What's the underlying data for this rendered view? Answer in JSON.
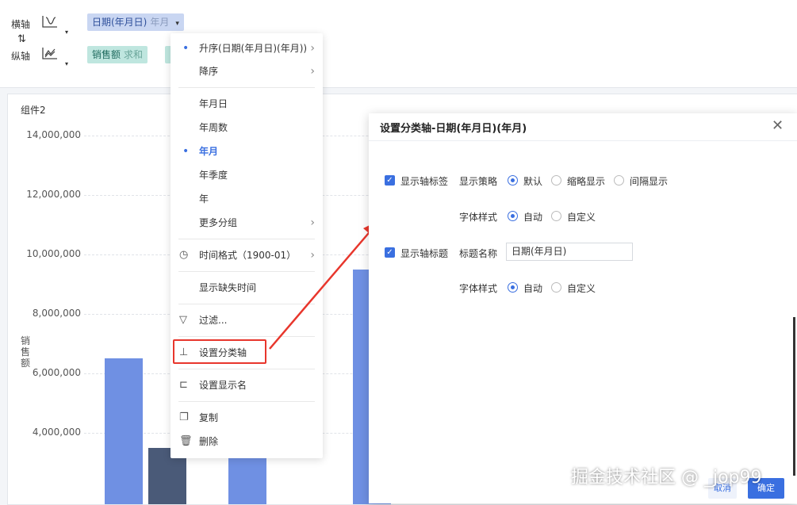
{
  "axis_bar": {
    "x_label": "横轴",
    "swap_glyph": "⇅",
    "y_label": "纵轴",
    "x_pill": {
      "text": "日期(年月日)",
      "sub": "年月",
      "caret": "▾"
    },
    "y_pill": {
      "text": "销售额",
      "sub": "求和"
    },
    "icons": [
      "axis-x-icon",
      "axis-y-icon",
      "swap-icon"
    ]
  },
  "chart": {
    "title": "组件2",
    "ylabel": "销\n售\n额",
    "bar_color": "#6f90e3",
    "bar2_color": "#4a5a78"
  },
  "chart_data": {
    "type": "bar",
    "title": "组件2",
    "ylabel": "销售额",
    "yticks": [
      "14,000,000",
      "12,000,000",
      "10,000,000",
      "8,000,000",
      "6,000,000",
      "4,000,000"
    ],
    "ylim": [
      2000000,
      14600000
    ],
    "series": [
      {
        "values": [
          6500000,
          null,
          9500000
        ]
      },
      {
        "values": [
          null,
          3500000,
          null
        ]
      }
    ],
    "partial_bars": [
      {
        "series": 0,
        "value": 6500000
      },
      {
        "series": 1,
        "value": 3500000
      },
      {
        "series": 0,
        "value": 3500000
      },
      {
        "series": 0,
        "value": 9500000
      }
    ]
  },
  "menu": {
    "items": [
      {
        "label": "升序(日期(年月日)(年月))",
        "dot": true,
        "chevron": true
      },
      {
        "label": "降序",
        "chevron": true
      },
      {
        "label": "年月日"
      },
      {
        "label": "年周数"
      },
      {
        "label": "年月",
        "dot": true,
        "active": true
      },
      {
        "label": "年季度"
      },
      {
        "label": "年"
      },
      {
        "label": "更多分组",
        "chevron": true
      },
      {
        "label": "时间格式（1900-01）",
        "icon": "clock-icon",
        "chevron": true
      },
      {
        "label": "显示缺失时间"
      },
      {
        "label": "过滤...",
        "icon": "filter-icon"
      },
      {
        "label": "设置分类轴",
        "icon": "axis-settings-icon"
      },
      {
        "label": "设置显示名",
        "icon": "rename-icon"
      },
      {
        "label": "复制",
        "icon": "copy-icon"
      },
      {
        "label": "删除",
        "icon": "trash-icon"
      }
    ]
  },
  "dialog": {
    "title": "设置分类轴-日期(年月日)(年月)",
    "close_glyph": "✕",
    "show_axis_label": {
      "label": "显示轴标签",
      "checked": true
    },
    "strategy": {
      "label": "显示策略",
      "options": [
        "默认",
        "缩略显示",
        "间隔显示"
      ],
      "selected": "默认"
    },
    "font_style_1": {
      "label": "字体样式",
      "options": [
        "自动",
        "自定义"
      ],
      "selected": "自动"
    },
    "show_axis_title": {
      "label": "显示轴标题",
      "checked": true
    },
    "title_name": {
      "label": "标题名称",
      "value": "日期(年月日)"
    },
    "font_style_2": {
      "label": "字体样式",
      "options": [
        "自动",
        "自定义"
      ],
      "selected": "自动"
    },
    "cancel": "取消",
    "ok": "确定"
  },
  "watermark": "掘金技术社区 @ _jop99",
  "colors": {
    "accent": "#3a6fe0",
    "highlight": "#e8362c"
  }
}
